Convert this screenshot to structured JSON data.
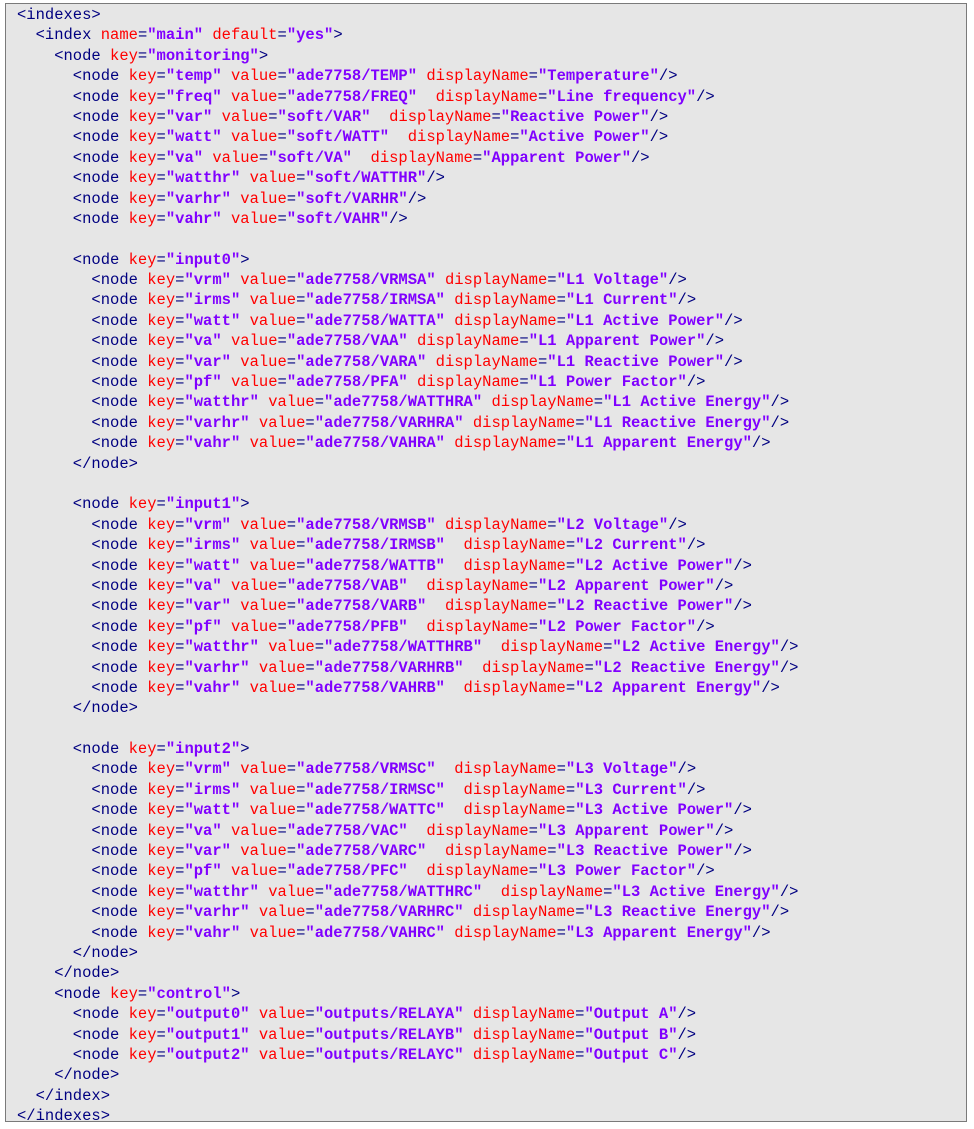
{
  "lines": [
    "<indexes>",
    "  <index name=\"main\" default=\"yes\">",
    "    <node key=\"monitoring\">",
    "      <node key=\"temp\" value=\"ade7758/TEMP\" displayName=\"Temperature\"/>",
    "      <node key=\"freq\" value=\"ade7758/FREQ\"  displayName=\"Line frequency\"/>",
    "      <node key=\"var\" value=\"soft/VAR\"  displayName=\"Reactive Power\"/>",
    "      <node key=\"watt\" value=\"soft/WATT\"  displayName=\"Active Power\"/>",
    "      <node key=\"va\" value=\"soft/VA\"  displayName=\"Apparent Power\"/>",
    "      <node key=\"watthr\" value=\"soft/WATTHR\"/>",
    "      <node key=\"varhr\" value=\"soft/VARHR\"/>",
    "      <node key=\"vahr\" value=\"soft/VAHR\"/>",
    "",
    "      <node key=\"input0\">",
    "        <node key=\"vrm\" value=\"ade7758/VRMSA\" displayName=\"L1 Voltage\"/>",
    "        <node key=\"irms\" value=\"ade7758/IRMSA\" displayName=\"L1 Current\"/>",
    "        <node key=\"watt\" value=\"ade7758/WATTA\" displayName=\"L1 Active Power\"/>",
    "        <node key=\"va\" value=\"ade7758/VAA\" displayName=\"L1 Apparent Power\"/>",
    "        <node key=\"var\" value=\"ade7758/VARA\" displayName=\"L1 Reactive Power\"/>",
    "        <node key=\"pf\" value=\"ade7758/PFA\" displayName=\"L1 Power Factor\"/>",
    "        <node key=\"watthr\" value=\"ade7758/WATTHRA\" displayName=\"L1 Active Energy\"/>",
    "        <node key=\"varhr\" value=\"ade7758/VARHRA\" displayName=\"L1 Reactive Energy\"/>",
    "        <node key=\"vahr\" value=\"ade7758/VAHRA\" displayName=\"L1 Apparent Energy\"/>",
    "      </node>",
    "",
    "      <node key=\"input1\">",
    "        <node key=\"vrm\" value=\"ade7758/VRMSB\" displayName=\"L2 Voltage\"/>",
    "        <node key=\"irms\" value=\"ade7758/IRMSB\"  displayName=\"L2 Current\"/>",
    "        <node key=\"watt\" value=\"ade7758/WATTB\"  displayName=\"L2 Active Power\"/>",
    "        <node key=\"va\" value=\"ade7758/VAB\"  displayName=\"L2 Apparent Power\"/>",
    "        <node key=\"var\" value=\"ade7758/VARB\"  displayName=\"L2 Reactive Power\"/>",
    "        <node key=\"pf\" value=\"ade7758/PFB\"  displayName=\"L2 Power Factor\"/>",
    "        <node key=\"watthr\" value=\"ade7758/WATTHRB\"  displayName=\"L2 Active Energy\"/>",
    "        <node key=\"varhr\" value=\"ade7758/VARHRB\"  displayName=\"L2 Reactive Energy\"/>",
    "        <node key=\"vahr\" value=\"ade7758/VAHRB\"  displayName=\"L2 Apparent Energy\"/>",
    "      </node>",
    "",
    "      <node key=\"input2\">",
    "        <node key=\"vrm\" value=\"ade7758/VRMSC\"  displayName=\"L3 Voltage\"/>",
    "        <node key=\"irms\" value=\"ade7758/IRMSC\"  displayName=\"L3 Current\"/>",
    "        <node key=\"watt\" value=\"ade7758/WATTC\"  displayName=\"L3 Active Power\"/>",
    "        <node key=\"va\" value=\"ade7758/VAC\"  displayName=\"L3 Apparent Power\"/>",
    "        <node key=\"var\" value=\"ade7758/VARC\"  displayName=\"L3 Reactive Power\"/>",
    "        <node key=\"pf\" value=\"ade7758/PFC\"  displayName=\"L3 Power Factor\"/>",
    "        <node key=\"watthr\" value=\"ade7758/WATTHRC\"  displayName=\"L3 Active Energy\"/>",
    "        <node key=\"varhr\" value=\"ade7758/VARHRC\" displayName=\"L3 Reactive Energy\"/>",
    "        <node key=\"vahr\" value=\"ade7758/VAHRC\" displayName=\"L3 Apparent Energy\"/>",
    "      </node>",
    "    </node>",
    "    <node key=\"control\">",
    "      <node key=\"output0\" value=\"outputs/RELAYA\" displayName=\"Output A\"/>",
    "      <node key=\"output1\" value=\"outputs/RELAYB\" displayName=\"Output B\"/>",
    "      <node key=\"output2\" value=\"outputs/RELAYC\" displayName=\"Output C\"/>",
    "    </node>",
    "  </index>",
    "</indexes>"
  ],
  "colors": {
    "panel_background": "#e6e6e6",
    "panel_border": "#7a7a7a",
    "tag": "#000080",
    "attribute_name": "#ff0000",
    "attribute_value": "#8000ff"
  }
}
